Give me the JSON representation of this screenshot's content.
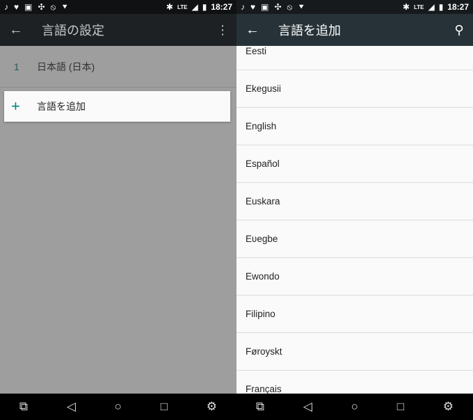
{
  "status_bar": {
    "time": "18:27",
    "network": "LTE",
    "notification_icons": [
      "music-icon",
      "heart-icon",
      "image-icon",
      "sync-icon",
      "rotate-icon",
      "download-icon"
    ]
  },
  "left": {
    "toolbar": {
      "title": "言語の設定",
      "back_icon": "arrow-left-icon",
      "menu_icon": "more-vert-icon"
    },
    "languages": [
      {
        "index": "1",
        "name": "日本語 (日本)"
      }
    ],
    "add_language": {
      "icon": "plus-icon",
      "label": "言語を追加"
    }
  },
  "right": {
    "toolbar": {
      "title": "言語を追加",
      "back_icon": "arrow-left-icon",
      "search_icon": "search-icon"
    },
    "languages": [
      "Eesti",
      "Ekegusii",
      "English",
      "Español",
      "Euskara",
      "Eʋegbe",
      "Ewondo",
      "Filipino",
      "Føroyskt",
      "Français"
    ]
  },
  "nav_bar": [
    "screenshot-icon",
    "back-icon",
    "home-icon",
    "recents-icon",
    "settings-icon"
  ],
  "colors": {
    "accent": "#00897b",
    "toolbar": "#263238"
  }
}
